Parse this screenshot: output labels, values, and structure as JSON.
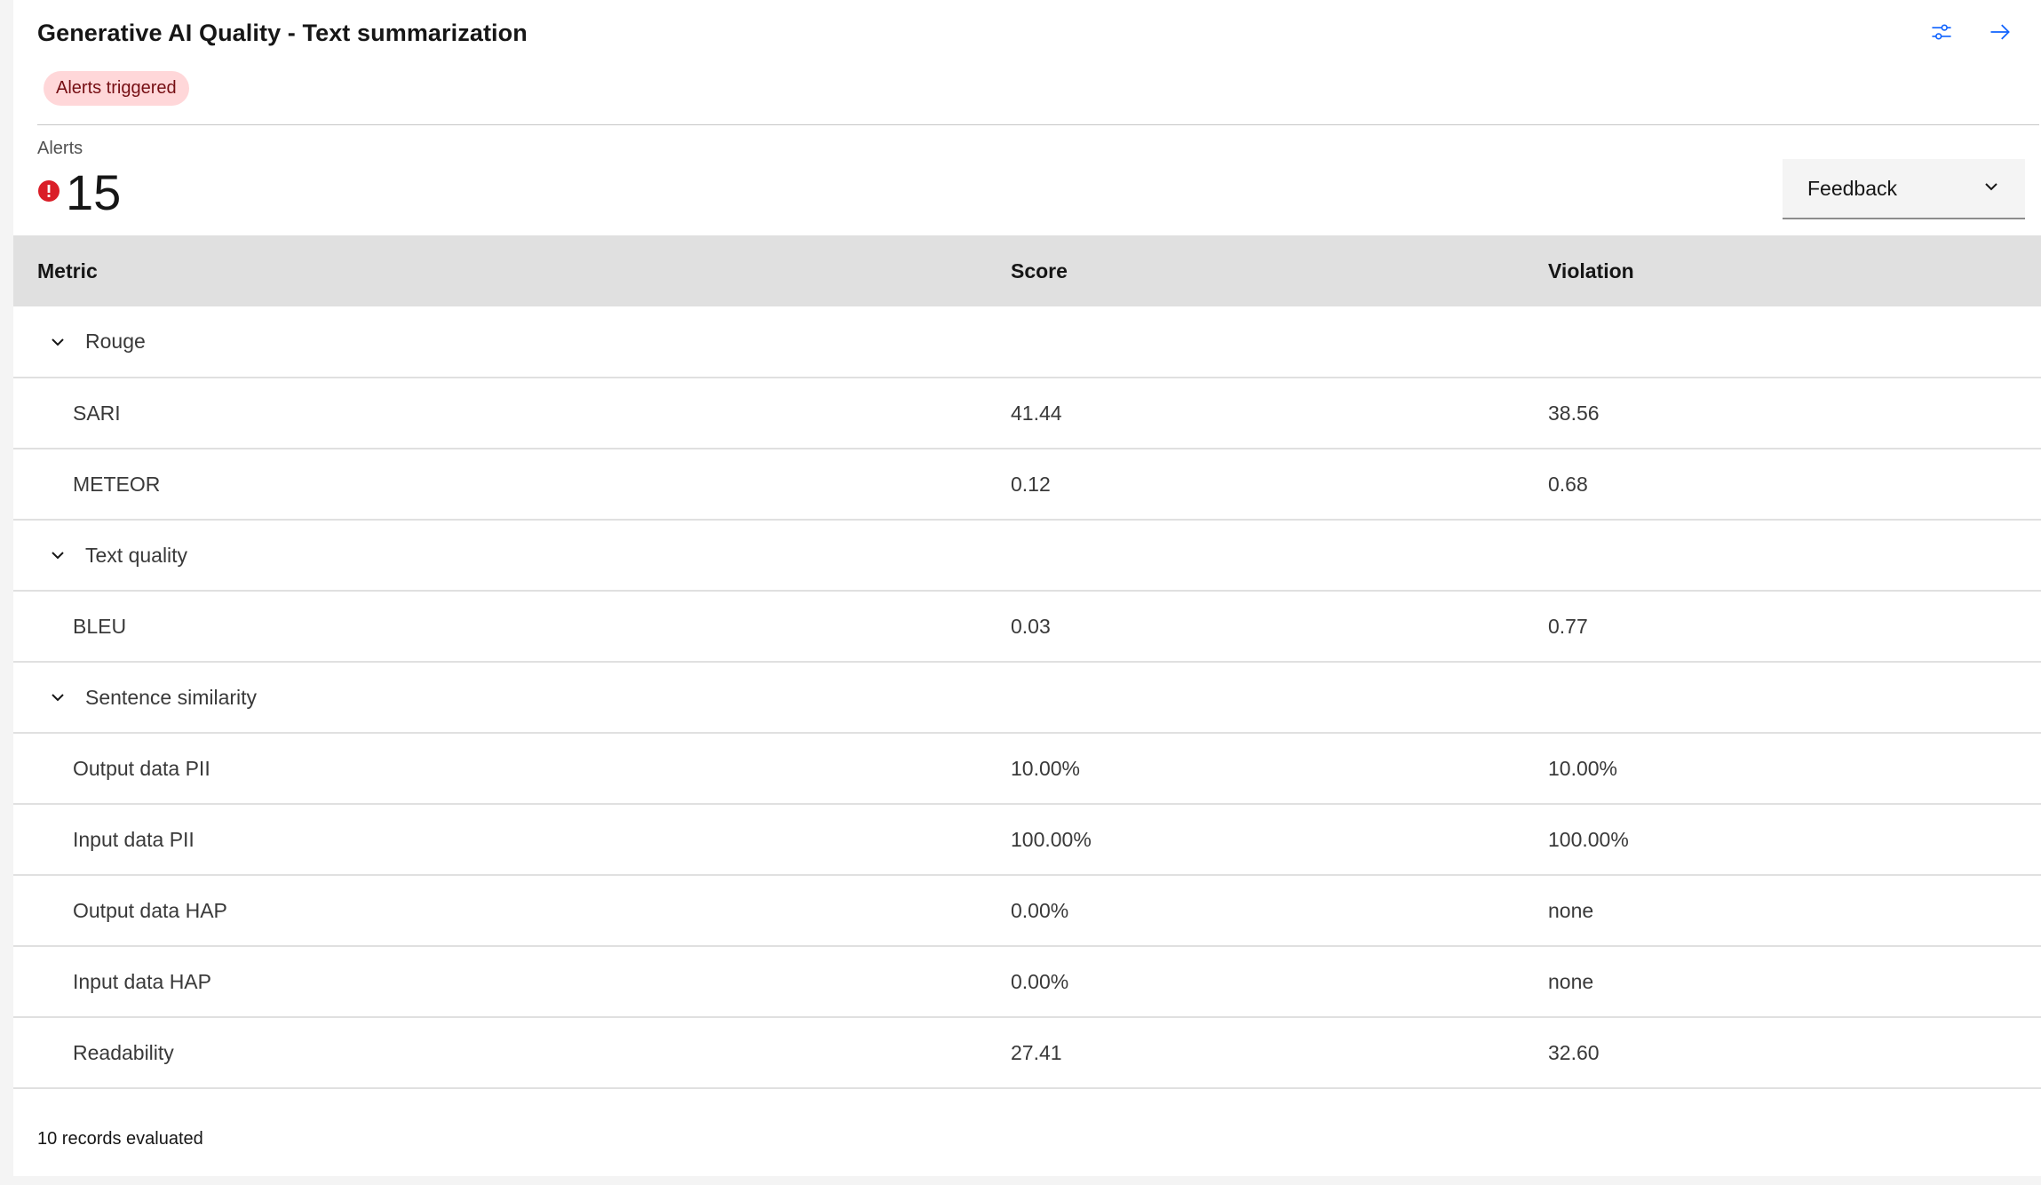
{
  "header": {
    "title": "Generative AI Quality - Text summarization",
    "tag": "Alerts triggered",
    "icons": [
      "settings-adjust-icon",
      "arrow-right-icon"
    ]
  },
  "alerts": {
    "label": "Alerts",
    "count": "15",
    "icon": "error-filled-icon"
  },
  "dropdown": {
    "selected": "Feedback"
  },
  "table": {
    "columns": [
      "Metric",
      "Score",
      "Violation"
    ],
    "rows": [
      {
        "type": "group",
        "metric": "Rouge",
        "score": "",
        "violation": ""
      },
      {
        "type": "item",
        "metric": "SARI",
        "score": "41.44",
        "violation": "38.56"
      },
      {
        "type": "item",
        "metric": "METEOR",
        "score": "0.12",
        "violation": "0.68"
      },
      {
        "type": "group",
        "metric": "Text quality",
        "score": "",
        "violation": ""
      },
      {
        "type": "item",
        "metric": "BLEU",
        "score": "0.03",
        "violation": "0.77"
      },
      {
        "type": "group",
        "metric": "Sentence similarity",
        "score": "",
        "violation": ""
      },
      {
        "type": "item",
        "metric": "Output data PII",
        "score": "10.00%",
        "violation": "10.00%"
      },
      {
        "type": "item",
        "metric": "Input data PII",
        "score": "100.00%",
        "violation": "100.00%"
      },
      {
        "type": "item",
        "metric": "Output data HAP",
        "score": "0.00%",
        "violation": "none"
      },
      {
        "type": "item",
        "metric": "Input data HAP",
        "score": "0.00%",
        "violation": "none"
      },
      {
        "type": "item",
        "metric": "Readability",
        "score": "27.41",
        "violation": "32.60"
      }
    ]
  },
  "footer": {
    "text": "10 records evaluated"
  },
  "colors": {
    "accent": "#0f62fe",
    "error": "#da1e28",
    "tag_bg": "#ffd7d9",
    "tag_text": "#750e13",
    "header_bg": "#e0e0e0"
  }
}
